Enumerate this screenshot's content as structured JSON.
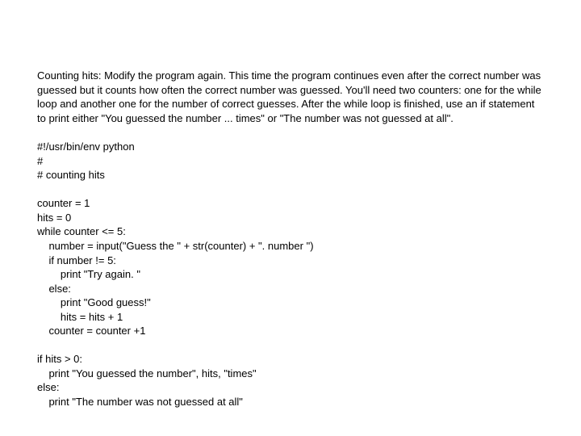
{
  "description": "Counting hits: Modify the program again. This time the program continues even after the correct number was guessed but it counts how often the correct number was guessed. You'll need two counters: one for the while loop and another one for the number of correct guesses. After the while loop is finished, use an if statement to print either \"You guessed the number ... times\" or \"The number was not guessed at all\".",
  "code": "#!/usr/bin/env python\n#\n# counting hits\n\ncounter = 1\nhits = 0\nwhile counter <= 5:\n    number = input(\"Guess the \" + str(counter) + \". number \")\n    if number != 5:\n        print \"Try again. \"\n    else:\n        print \"Good guess!\"\n        hits = hits + 1\n    counter = counter +1\n\nif hits > 0:\n    print \"You guessed the number\", hits, \"times\"\nelse:\n    print \"The number was not guessed at all\""
}
